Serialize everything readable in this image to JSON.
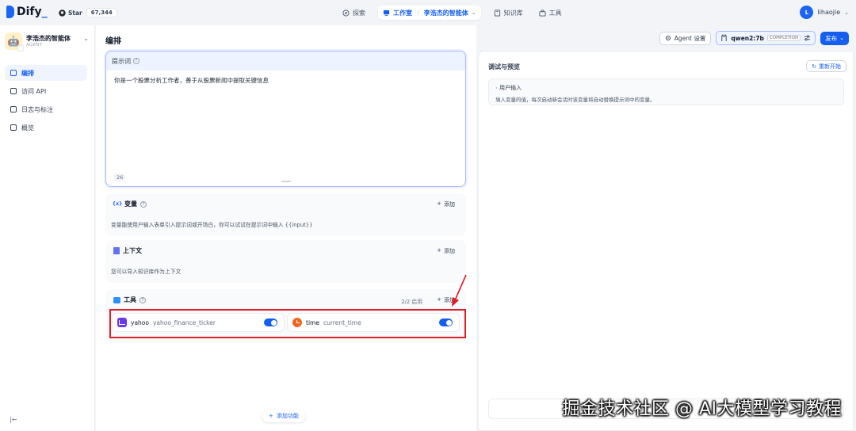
{
  "topbar": {
    "logo_text": "Dify",
    "github_star": "Star",
    "github_count": "67,344",
    "nav": [
      {
        "label": "探索",
        "icon": "compass-icon"
      },
      {
        "label": "工作室",
        "icon": "studio-icon",
        "app": "李浩杰的智能体"
      },
      {
        "label": "知识库",
        "icon": "book-icon"
      },
      {
        "label": "工具",
        "icon": "tool-icon"
      }
    ],
    "user_initial": "L",
    "user_name": "lihaojie"
  },
  "sidebar": {
    "app_name": "李浩杰的智能体",
    "app_type": "AGENT",
    "items": [
      {
        "label": "编排",
        "icon": "layout-icon",
        "active": true
      },
      {
        "label": "访问 API",
        "icon": "terminal-icon",
        "active": false
      },
      {
        "label": "日志与标注",
        "icon": "file-icon",
        "active": false
      },
      {
        "label": "概览",
        "icon": "chart-icon",
        "active": false
      }
    ]
  },
  "main": {
    "title": "编排",
    "prompt": {
      "label": "提示词",
      "text": "你是一个股票分析工作者，善于从股票新闻中提取关键信息",
      "char_count": "26"
    },
    "variables": {
      "title": "变量",
      "icon_text": "{x}",
      "add_label": "添加",
      "description": "变量能使用户输入表单引入提示词或开场白，你可以试试在提示词中输入 {{input}}"
    },
    "context": {
      "title": "上下文",
      "add_label": "添加",
      "description": "您可以导入知识库作为上下文"
    },
    "tools": {
      "title": "工具",
      "enabled_count": "2/2 启用",
      "add_label": "添加",
      "items": [
        {
          "provider": "yahoo",
          "name": "yahoo_finance_ticker",
          "icon": "chart-icon",
          "enabled": true
        },
        {
          "provider": "time",
          "name": "current_time",
          "icon": "clock-icon",
          "enabled": true
        }
      ]
    },
    "add_feature_label": "添加功能"
  },
  "actions": {
    "agent_settings": "Agent 设置",
    "model_name": "qwen2:7b",
    "model_mode": "COMPLETION",
    "publish": "发布"
  },
  "debug": {
    "title": "调试与预览",
    "restart_label": "重新开始",
    "user_input_title": "用户输入",
    "user_input_desc": "填入变量的值，每次启动新会话时该变量将自动替换提示词中的变量。"
  },
  "watermark": "掘金技术社区 @ AI大模型学习教程",
  "colors": {
    "accent": "#155eef",
    "highlight": "#e11d2a"
  }
}
